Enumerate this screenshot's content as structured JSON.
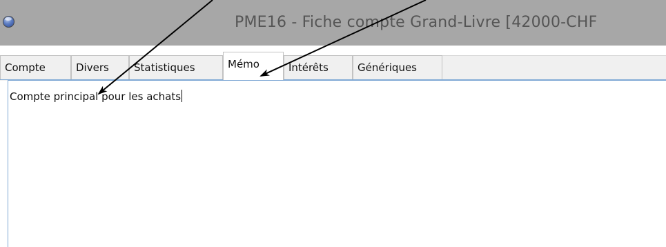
{
  "window": {
    "title": "PME16 - Fiche compte Grand-Livre [42000-CHF"
  },
  "tabs": [
    {
      "label": "Compte",
      "active": false
    },
    {
      "label": "Divers",
      "active": false
    },
    {
      "label": "Statistiques",
      "active": false
    },
    {
      "label": "Mémo",
      "active": true
    },
    {
      "label": "Intérêts",
      "active": false
    },
    {
      "label": "Génériques",
      "active": false
    }
  ],
  "memo": {
    "text": "Compte principal pour les achats"
  },
  "colors": {
    "titlebar": "#a7a7a7",
    "tab_row": "#f0f0f0",
    "accent_border": "#7ea8d4"
  },
  "icons": {
    "app": "app-globe-icon"
  }
}
